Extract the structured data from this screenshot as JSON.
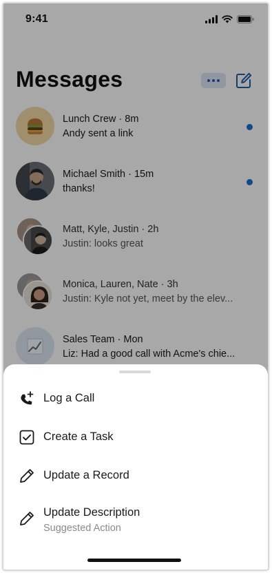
{
  "status_bar": {
    "time": "9:41"
  },
  "header": {
    "title": "Messages"
  },
  "conversations": [
    {
      "title": "Lunch Crew · 8m",
      "preview": "Andy sent a link",
      "unread": true
    },
    {
      "title": "Michael Smith · 15m",
      "preview": "thanks!",
      "unread": true
    },
    {
      "title": "Matt, Kyle, Justin · 2h",
      "preview": "Justin: looks great",
      "unread": false
    },
    {
      "title": "Monica, Lauren, Nate · 3h",
      "preview": "Justin: Kyle not yet, meet by the elev...",
      "unread": false
    },
    {
      "title": "Sales Team · Mon",
      "preview": "Liz: Had a good call with Acme's chie...",
      "unread": false
    }
  ],
  "action_sheet": {
    "items": [
      {
        "label": "Log a Call",
        "icon": "phone-plus-icon"
      },
      {
        "label": "Create a Task",
        "icon": "checkbox-icon"
      },
      {
        "label": "Update a Record",
        "icon": "pencil-icon"
      },
      {
        "label": "Update Description",
        "sublabel": "Suggested Action",
        "icon": "pencil-icon"
      }
    ]
  },
  "colors": {
    "accent": "#1f6ccf",
    "more_button_bg": "#dbe6f3",
    "overlay": "rgba(0,0,0,0.34)"
  }
}
